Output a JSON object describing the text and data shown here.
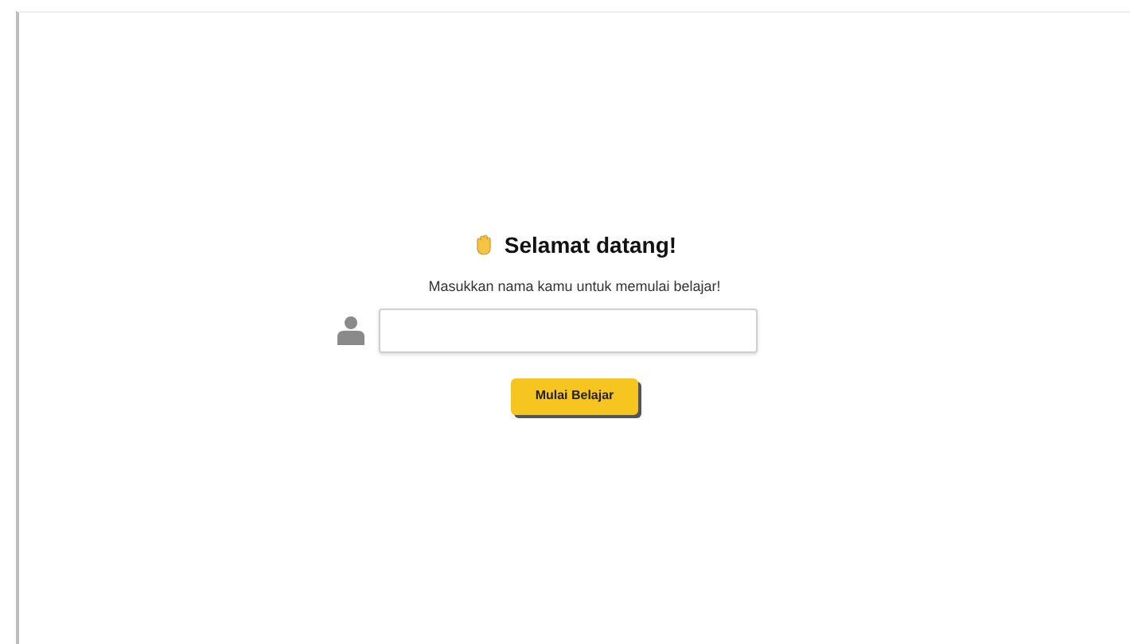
{
  "title": "Selamat datang!",
  "subtitle": "Masukkan nama kamu untuk memulai belajar!",
  "start_button": "Mulai Belajar"
}
